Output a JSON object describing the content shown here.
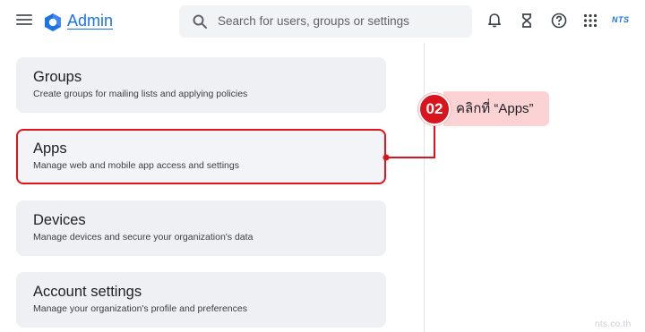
{
  "header": {
    "app_title": "Admin",
    "brand_logo_text": "NTS",
    "search": {
      "placeholder": "Search for users, groups or settings"
    },
    "icons": [
      "menu-icon",
      "admin-logo-icon",
      "search-icon",
      "bell-icon",
      "hourglass-icon",
      "help-icon",
      "apps-grid-icon"
    ]
  },
  "cards": [
    {
      "title": "Groups",
      "description": "Create groups for mailing lists and applying policies"
    },
    {
      "title": "Apps",
      "description": "Manage web and mobile app access and settings"
    },
    {
      "title": "Devices",
      "description": "Manage devices and secure your organization's data"
    },
    {
      "title": "Account settings",
      "description": "Manage your organization's profile and preferences"
    }
  ],
  "callout": {
    "step": "02",
    "label": "คลิกที่ “Apps”"
  },
  "watermark": "nts.co.th",
  "colors": {
    "accent_blue": "#1a73e8",
    "callout_red": "#d9141c",
    "callout_pink": "#fbd3d5",
    "card_bg": "#eef0f4"
  }
}
